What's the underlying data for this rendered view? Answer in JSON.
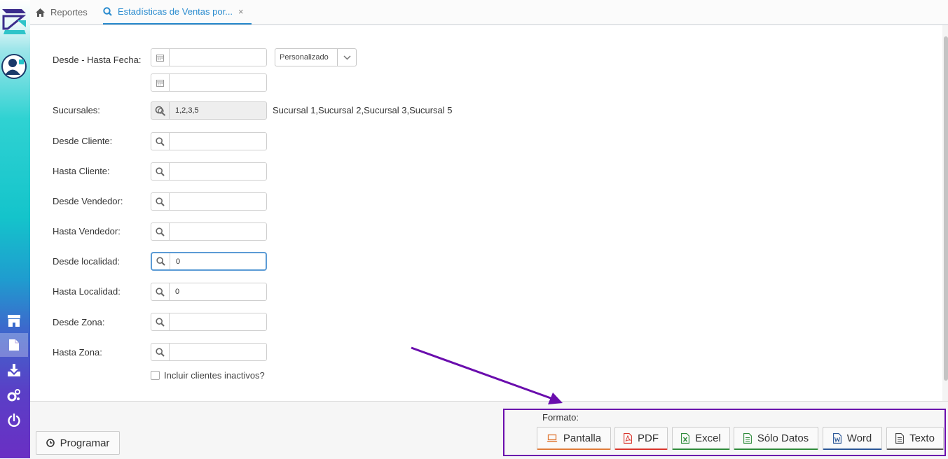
{
  "tabs": [
    {
      "label": "Reportes",
      "icon": "home-icon"
    },
    {
      "label": "Estadísticas de Ventas por...",
      "icon": "search-icon",
      "close": "×"
    }
  ],
  "sidebar": {
    "items": [
      {
        "name": "app-logo"
      },
      {
        "name": "user-avatar"
      },
      {
        "name": "store-icon"
      },
      {
        "name": "document-icon",
        "active": true
      },
      {
        "name": "download-icon"
      },
      {
        "name": "settings-icon"
      },
      {
        "name": "power-icon"
      }
    ]
  },
  "form": {
    "date_label": "Desde - Hasta Fecha:",
    "date_from": "",
    "date_to": "",
    "period_select": "Personalizado",
    "sucursales_label": "Sucursales:",
    "sucursales_value": "1,2,3,5",
    "sucursales_text": "Sucursal 1,Sucursal 2,Sucursal 3,Sucursal 5",
    "fields": [
      {
        "label": "Desde Cliente:",
        "value": ""
      },
      {
        "label": "Hasta Cliente:",
        "value": ""
      },
      {
        "label": "Desde Vendedor:",
        "value": ""
      },
      {
        "label": "Hasta Vendedor:",
        "value": ""
      },
      {
        "label": "Desde localidad:",
        "value": "0"
      },
      {
        "label": "Hasta Localidad:",
        "value": "0"
      },
      {
        "label": "Desde Zona:",
        "value": ""
      },
      {
        "label": "Hasta Zona:",
        "value": ""
      }
    ],
    "checkbox_label": "Incluir clientes inactivos?",
    "checkbox_checked": false
  },
  "footer": {
    "programar_label": "Programar",
    "formato_label": "Formato:",
    "buttons": [
      {
        "label": "Pantalla",
        "icon": "laptop-icon",
        "accent": "#e07b39"
      },
      {
        "label": "PDF",
        "icon": "pdf-icon",
        "accent": "#d9342b"
      },
      {
        "label": "Excel",
        "icon": "excel-icon",
        "accent": "#2e8b3a"
      },
      {
        "label": "Sólo Datos",
        "icon": "data-file-icon",
        "accent": "#2e8b3a"
      },
      {
        "label": "Word",
        "icon": "word-icon",
        "accent": "#2b5797"
      },
      {
        "label": "Texto",
        "icon": "text-file-icon",
        "accent": "#555555"
      }
    ]
  },
  "colors": {
    "accent": "#2b8ccf",
    "annotation": "#6a0dad",
    "focus": "#5b9bd5"
  }
}
